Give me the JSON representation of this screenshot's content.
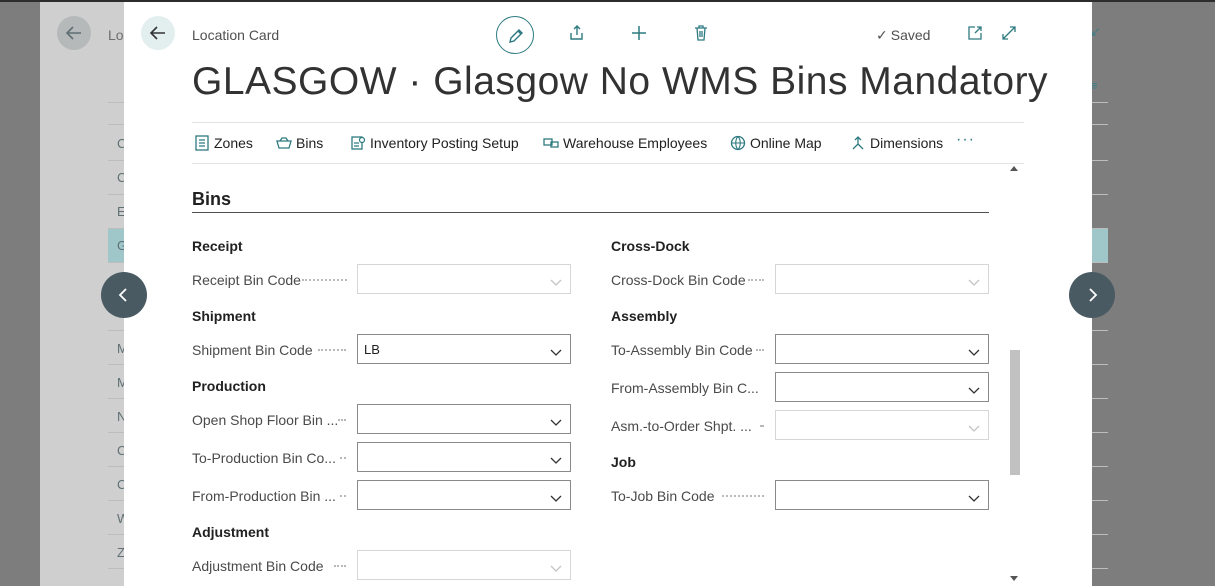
{
  "background": {
    "title": "Lo",
    "row_letters": [
      "C",
      "C",
      "E",
      "G",
      "M",
      "M",
      "N",
      "C",
      "C",
      "W",
      "Z"
    ]
  },
  "header": {
    "breadcrumb": "Location Card",
    "status": "Saved",
    "title": "GLASGOW · Glasgow No WMS Bins Mandatory"
  },
  "toolbar": {
    "edit": "pencil-icon",
    "share": "share-icon",
    "new": "plus-icon",
    "delete": "trash-icon",
    "open_new_window": "open-in-new-window-icon",
    "expand": "expand-icon"
  },
  "actions": [
    {
      "label": "Zones",
      "icon": "zones-icon"
    },
    {
      "label": "Bins",
      "icon": "bins-icon"
    },
    {
      "label": "Inventory Posting Setup",
      "icon": "setup-icon"
    },
    {
      "label": "Warehouse Employees",
      "icon": "employees-icon"
    },
    {
      "label": "Online Map",
      "icon": "globe-icon"
    },
    {
      "label": "Dimensions",
      "icon": "dimensions-icon"
    }
  ],
  "more_label": "···",
  "section": {
    "title": "Bins",
    "left": {
      "receipt": {
        "heading": "Receipt",
        "fields": [
          {
            "label": "Receipt Bin Code",
            "value": ""
          }
        ]
      },
      "shipment": {
        "heading": "Shipment",
        "fields": [
          {
            "label": "Shipment Bin Code",
            "value": "LB"
          }
        ]
      },
      "production": {
        "heading": "Production",
        "fields": [
          {
            "label": "Open Shop Floor Bin ...",
            "value": ""
          },
          {
            "label": "To-Production Bin Co...",
            "value": ""
          },
          {
            "label": "From-Production Bin ...",
            "value": ""
          }
        ]
      },
      "adjustment": {
        "heading": "Adjustment",
        "fields": [
          {
            "label": "Adjustment Bin Code",
            "value": ""
          }
        ]
      }
    },
    "right": {
      "crossdock": {
        "heading": "Cross-Dock",
        "fields": [
          {
            "label": "Cross-Dock Bin Code",
            "value": ""
          }
        ]
      },
      "assembly": {
        "heading": "Assembly",
        "fields": [
          {
            "label": "To-Assembly Bin Code",
            "value": ""
          },
          {
            "label": "From-Assembly Bin C...",
            "value": ""
          },
          {
            "label": "Asm.-to-Order Shpt. ...",
            "value": ""
          }
        ]
      },
      "job": {
        "heading": "Job",
        "fields": [
          {
            "label": "To-Job Bin Code",
            "value": ""
          }
        ]
      }
    }
  },
  "colors": {
    "accent": "#2c7a80",
    "nav_circle": "#4a5a63"
  }
}
